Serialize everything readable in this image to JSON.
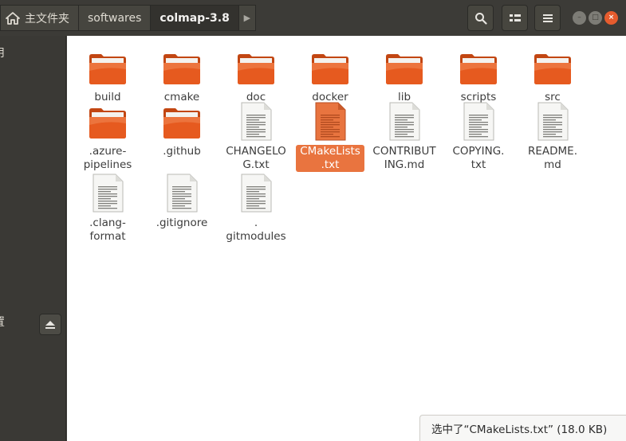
{
  "breadcrumb": {
    "home_label": "主文件夹",
    "items": [
      "softwares",
      "colmap-3.8"
    ],
    "next_arrow": "▶"
  },
  "toolbar": {
    "search_icon": "search-icon",
    "view_icon": "grid-view-icon",
    "menu_icon": "hamburger-menu-icon"
  },
  "window_controls": {
    "minimize": "–",
    "maximize": "□",
    "close": "×"
  },
  "sidebar": {
    "partial_items": [
      "用",
      "置"
    ]
  },
  "files": [
    {
      "name": "build",
      "type": "folder"
    },
    {
      "name": "cmake",
      "type": "folder"
    },
    {
      "name": "doc",
      "type": "folder"
    },
    {
      "name": "docker",
      "type": "folder"
    },
    {
      "name": "lib",
      "type": "folder"
    },
    {
      "name": "scripts",
      "type": "folder"
    },
    {
      "name": "src",
      "type": "folder"
    },
    {
      "name": ".azure-\npipelines",
      "type": "folder"
    },
    {
      "name": ".github",
      "type": "folder"
    },
    {
      "name": "CHANGELO\nG.txt",
      "type": "text"
    },
    {
      "name": "CMakeLists\n.txt",
      "type": "text",
      "selected": true
    },
    {
      "name": "CONTRIBUT\nING.md",
      "type": "text"
    },
    {
      "name": "COPYING.\ntxt",
      "type": "text"
    },
    {
      "name": "README.\nmd",
      "type": "text"
    },
    {
      "name": ".clang-\nformat",
      "type": "text"
    },
    {
      "name": ".gitignore",
      "type": "text"
    },
    {
      "name": ".\ngitmodules",
      "type": "text"
    }
  ],
  "status": "选中了“CMakeLists.txt” (18.0 KB)",
  "colors": {
    "accent": "#e9743f",
    "folder": "#e65a1f",
    "titlebar": "#3c3b37"
  }
}
